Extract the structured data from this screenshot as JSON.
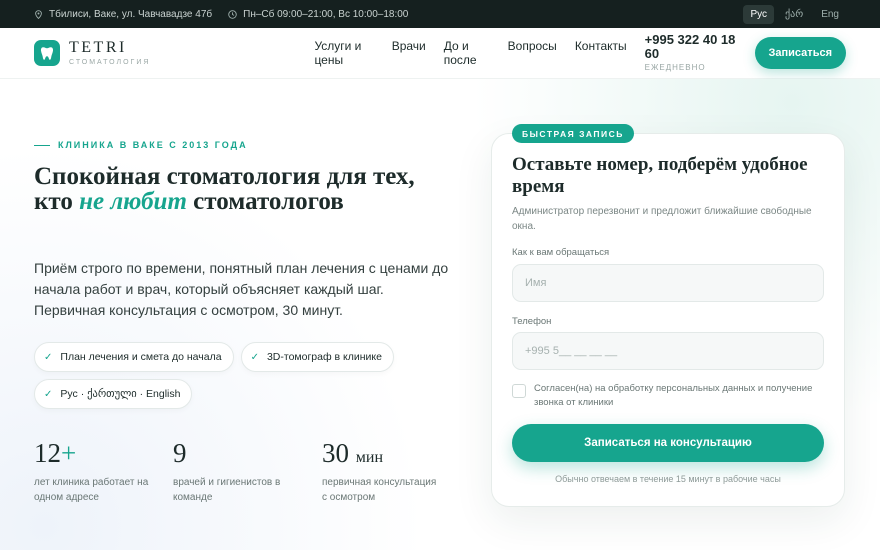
{
  "topbar": {
    "address": "Тбилиси, Ваке, ул. Чавчавадзе 47б",
    "hours": "Пн–Сб 09:00–21:00, Вс 10:00–18:00",
    "languages": [
      "Рус",
      "ქარ",
      "Eng"
    ],
    "active_language": "Рус"
  },
  "header": {
    "logo_name": "TETRI",
    "logo_sub": "СТОМАТОЛОГИЯ",
    "nav": [
      "Услуги и цены",
      "Врачи",
      "До и после",
      "Вопросы",
      "Контакты"
    ],
    "phone": "+995 322 40 18 60",
    "phone_sub": "ЕЖЕДНЕВНО",
    "cta": "Записаться"
  },
  "hero": {
    "eyebrow": "КЛИНИКА В ВАКЕ С 2013 ГОДА",
    "headline_start": "Спокойная стоматология для тех, кто ",
    "headline_accent": "не любит",
    "headline_end": " стоматологов",
    "lead": "Приём строго по времени, понятный план лечения с ценами до начала работ и врач, который объясняет каждый шаг. Первичная консультация с осмотром, 30 минут.",
    "chips": [
      "План лечения и смета до начала",
      "3D-томограф в клинике",
      "Рус · ქართული · English"
    ],
    "stats": [
      {
        "value": "12",
        "suffix": "+",
        "label": "лет клиника работает на одном адресе"
      },
      {
        "value": "9",
        "suffix": "",
        "label": "врачей и гигиенистов в команде"
      },
      {
        "value": "30",
        "suffix": "мин",
        "label": "первичная консультация с осмотром"
      }
    ]
  },
  "form": {
    "badge": "БЫСТРАЯ ЗАПИСЬ",
    "title": "Оставьте номер, подберём удобное время",
    "description": "Администратор перезвонит и предложит ближайшие свободные окна.",
    "name_label": "Как к вам обращаться",
    "name_placeholder": "Имя",
    "phone_label": "Телефон",
    "phone_placeholder": "+995 5__ __ __ __",
    "consent": "Согласен(на) на обработку персональных данных и получение звонка от клиники",
    "submit": "Записаться на консультацию",
    "note": "Обычно отвечаем в течение 15 минут в рабочие часы"
  },
  "colors": {
    "accent": "#16a58e",
    "topbar_bg": "#15201f",
    "text": "#1d2b2a"
  }
}
